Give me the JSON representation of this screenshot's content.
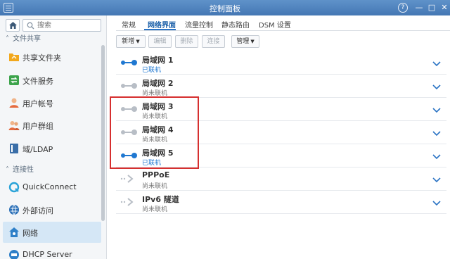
{
  "window": {
    "title": "控制面板",
    "controls": [
      "?",
      "—",
      "□",
      "✕"
    ]
  },
  "sidebar": {
    "search_placeholder": "搜索",
    "sections": [
      {
        "label": "文件共享"
      },
      {
        "label": "连接性"
      }
    ],
    "items": [
      {
        "label": "共享文件夹",
        "icon": "shared-folder-icon",
        "color": "#f2a81d"
      },
      {
        "label": "文件服务",
        "icon": "file-services-icon",
        "color": "#3ca34b"
      },
      {
        "label": "用户帐号",
        "icon": "user-icon",
        "color": "#e56b3f"
      },
      {
        "label": "用户群组",
        "icon": "group-icon",
        "color": "#e56b3f"
      },
      {
        "label": "域/LDAP",
        "icon": "domain-ldap-icon",
        "color": "#3a6ea8"
      },
      {
        "label": "QuickConnect",
        "icon": "quickconnect-icon",
        "color": "#2aa3d8"
      },
      {
        "label": "外部访问",
        "icon": "globe-icon",
        "color": "#2a6fb7"
      },
      {
        "label": "网络",
        "icon": "network-house-icon",
        "color": "#2f80c8",
        "active": true
      },
      {
        "label": "DHCP Server",
        "icon": "dhcp-server-icon",
        "color": "#2f80c8"
      }
    ]
  },
  "tabs": [
    {
      "label": "常规"
    },
    {
      "label": "网络界面",
      "active": true
    },
    {
      "label": "流量控制"
    },
    {
      "label": "静态路由"
    },
    {
      "label": "DSM 设置"
    }
  ],
  "toolbar": {
    "new_label": "新增",
    "edit_label": "编辑",
    "delete_label": "删除",
    "connect_label": "连接",
    "manage_label": "管理"
  },
  "interfaces": [
    {
      "name": "局域网 1",
      "status": "已联机",
      "connected": true,
      "type": "lan"
    },
    {
      "name": "局域网 2",
      "status": "尚未联机",
      "connected": false,
      "type": "lan"
    },
    {
      "name": "局域网 3",
      "status": "尚未联机",
      "connected": false,
      "type": "lan"
    },
    {
      "name": "局域网 4",
      "status": "尚未联机",
      "connected": false,
      "type": "lan"
    },
    {
      "name": "局域网 5",
      "status": "已联机",
      "connected": true,
      "type": "lan"
    },
    {
      "name": "PPPoE",
      "status": "尚未联机",
      "connected": false,
      "type": "tunnel"
    },
    {
      "name": "IPv6 隧道",
      "status": "尚未联机",
      "connected": false,
      "type": "tunnel"
    }
  ],
  "colors": {
    "accent": "#2a73c4",
    "connected": "#1f78d1",
    "disconnected": "#b8bec6",
    "highlight": "#d62f2f"
  }
}
